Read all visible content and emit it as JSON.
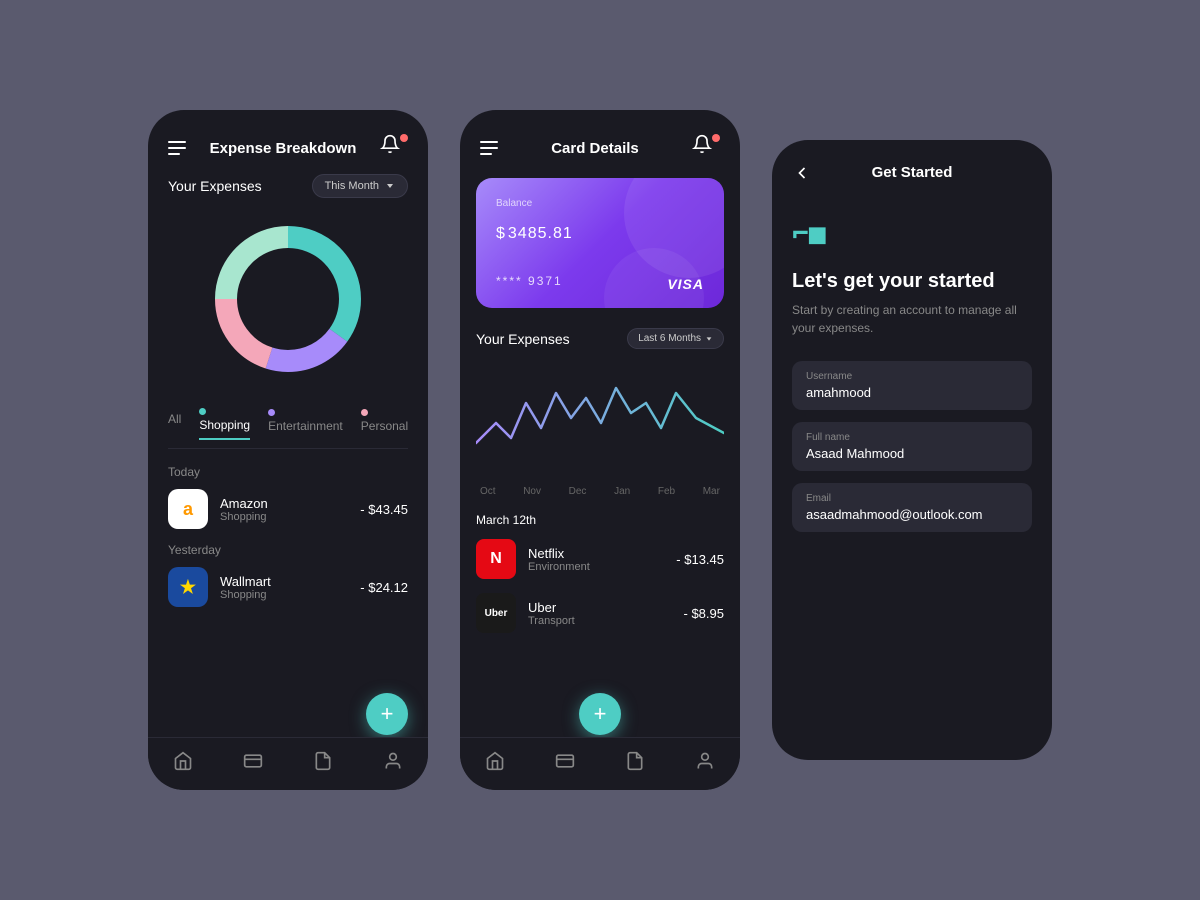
{
  "phone1": {
    "header": {
      "title": "Expense Breakdown",
      "notif_label": "notifications"
    },
    "expenses": {
      "title": "Your Expenses",
      "filter": "This Month"
    },
    "donut": {
      "segments": [
        {
          "color": "#4ecdc4",
          "percent": 35
        },
        {
          "color": "#a78bfa",
          "percent": 20
        },
        {
          "color": "#f4a7b9",
          "percent": 20
        },
        {
          "color": "#a8e6cf",
          "percent": 25
        }
      ]
    },
    "tabs": [
      {
        "label": "All",
        "dot": null,
        "active": false
      },
      {
        "label": "Shopping",
        "dot": "#4ecdc4",
        "active": true
      },
      {
        "label": "Entertainment",
        "dot": "#a78bfa",
        "active": false
      },
      {
        "label": "Personal",
        "dot": "#f4a7b9",
        "active": false
      }
    ],
    "today_label": "Today",
    "yesterday_label": "Yesterday",
    "transactions": [
      {
        "name": "Amazon",
        "category": "Shopping",
        "amount": "- $43.45",
        "logo_text": "a",
        "logo_bg": "#fff",
        "logo_color": "#ff9900",
        "day": "today"
      },
      {
        "name": "Wallmart",
        "category": "Shopping",
        "amount": "- $24.12",
        "logo_text": "★",
        "logo_bg": "#1a4a9e",
        "logo_color": "#ffd700",
        "day": "yesterday"
      }
    ],
    "fab_label": "+"
  },
  "phone2": {
    "header": {
      "title": "Card Details"
    },
    "card": {
      "balance_label": "Balance",
      "balance": "3485.81",
      "currency": "$",
      "number": "**** 9371",
      "network": "VISA"
    },
    "expenses": {
      "title": "Your Expenses",
      "period": "Last 6 Months"
    },
    "chart_labels": [
      "Oct",
      "Nov",
      "Dec",
      "Jan",
      "Feb",
      "Mar"
    ],
    "date_label": "March 12th",
    "transactions": [
      {
        "name": "Netflix",
        "category": "Environment",
        "amount": "- $13.45",
        "logo_color": "#e50914",
        "logo_text": "N"
      },
      {
        "name": "Uber",
        "category": "Transport",
        "amount": "- $8.95",
        "logo_color": "#1a1a1a",
        "logo_text": "Uber"
      }
    ],
    "fab_label": "+"
  },
  "phone3": {
    "header": {
      "title": "Get Started",
      "back_label": "←"
    },
    "brand_icon": "⌐",
    "heading": "Let's get your started",
    "subtext": "Start by creating an account to manage all your expenses.",
    "fields": [
      {
        "label": "Username",
        "value": "amahmood"
      },
      {
        "label": "Full name",
        "value": "Asaad Mahmood"
      },
      {
        "label": "Email",
        "value": "asaadmahmood@outlook.com"
      }
    ]
  },
  "nav": {
    "home": "home",
    "cards": "cards",
    "history": "history",
    "profile": "profile"
  },
  "colors": {
    "accent": "#4ecdc4",
    "bg": "#1a1a22",
    "card_bg": "#2a2a36",
    "danger": "#ff6b6b",
    "purple": "#a78bfa",
    "pink": "#f4a7b9",
    "green": "#a8e6cf"
  }
}
